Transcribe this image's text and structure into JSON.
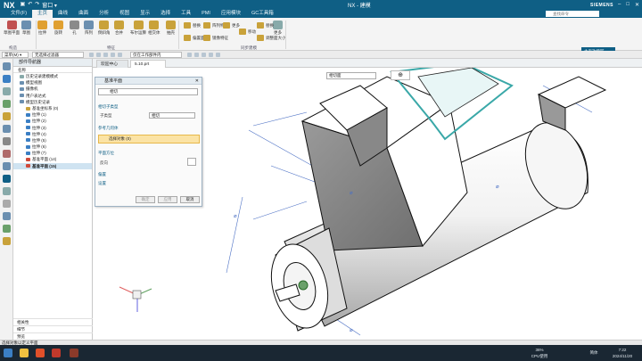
{
  "app": {
    "logo": "NX",
    "window_title": "NX - 建模",
    "brand": "SIEMENS",
    "quick_window": "窗口 ▾"
  },
  "menu": {
    "items": [
      "文件(F)",
      "主页",
      "曲线",
      "曲面",
      "分析",
      "视图",
      "显示",
      "选择",
      "工具",
      "PMI",
      "应用模块",
      "GC工具箱"
    ],
    "active_index": 1,
    "search_placeholder": "查找命令"
  },
  "ribbon": {
    "big_buttons": [
      "草图平面",
      "草图",
      "拉伸",
      "旋转",
      "孔",
      "阵列",
      "倒斜角",
      "合并",
      "布尔运算",
      "相交体",
      "抽壳",
      "更多"
    ],
    "small_buttons": [
      "替换",
      "阵列特征",
      "偏置面",
      "镜像特征",
      "更多",
      "移动",
      "替换",
      "调整面大小"
    ],
    "groups": [
      "构造",
      "特征",
      "同步建模"
    ],
    "side_panel": "主页功能区"
  },
  "filterbar": {
    "menu_label": "菜单(M) ▾",
    "filter_value": "无选择过滤器",
    "scope_value": "仅在工作部件内"
  },
  "navigator": {
    "title": "部件导航器",
    "column": "名称",
    "rows": [
      {
        "text": "历史记录建模模式",
        "indent": 1,
        "icon": "#8aa"
      },
      {
        "text": "模型视图",
        "indent": 1,
        "icon": "#6b8fb0"
      },
      {
        "text": "摄像机",
        "indent": 1,
        "icon": "#6b8fb0"
      },
      {
        "text": "用户表达式",
        "indent": 1,
        "icon": "#6b8fb0"
      },
      {
        "text": "模型历史记录",
        "indent": 1,
        "icon": "#6b8fb0"
      },
      {
        "text": "基准坐标系 (0)",
        "indent": 2,
        "icon": "#c9a23a"
      },
      {
        "text": "拉伸 (1)",
        "indent": 2,
        "icon": "#3b7fc4"
      },
      {
        "text": "拉伸 (2)",
        "indent": 2,
        "icon": "#3b7fc4"
      },
      {
        "text": "拉伸 (3)",
        "indent": 2,
        "icon": "#3b7fc4"
      },
      {
        "text": "拉伸 (4)",
        "indent": 2,
        "icon": "#3b7fc4"
      },
      {
        "text": "拉伸 (5)",
        "indent": 2,
        "icon": "#3b7fc4"
      },
      {
        "text": "拉伸 (6)",
        "indent": 2,
        "icon": "#3b7fc4"
      },
      {
        "text": "拉伸 (7)",
        "indent": 2,
        "icon": "#3b7fc4"
      },
      {
        "text": "基准平面 (14)",
        "indent": 2,
        "icon": "#d04a3a"
      },
      {
        "text": "基准平面 (15)",
        "indent": 2,
        "icon": "#d04a3a"
      }
    ],
    "selected_index": 14,
    "bottom_sections": [
      "相关性",
      "细节",
      "预览"
    ]
  },
  "tabs": [
    "欢迎中心",
    "5.10.prt"
  ],
  "active_tab": 1,
  "viewport": {
    "dropdown_value": "相切面"
  },
  "dialog": {
    "title": "基准平面",
    "type_value": "相切",
    "section_subtype": "相切子类型",
    "subtype_label": "子类型",
    "subtype_value": "相切",
    "section_ref": "参考几何体",
    "select_object": "选择对象 (0)",
    "section_orient": "平面方位",
    "reverse_label": "反向",
    "section_offset": "偏置",
    "section_settings": "设置",
    "ok": "确定",
    "apply": "应用",
    "cancel": "取消"
  },
  "status": {
    "text": "选择对象以定义平面"
  },
  "taskbar": {
    "cpu": "36%",
    "cpu_label": "CPU使用",
    "lang": "简体",
    "time": "7:22",
    "date": "2024/11/20"
  },
  "colors": {
    "title_blue": "#0f5f85",
    "model_teal": "#3aa8a8",
    "highlight_yellow": "#fbe3a5"
  }
}
